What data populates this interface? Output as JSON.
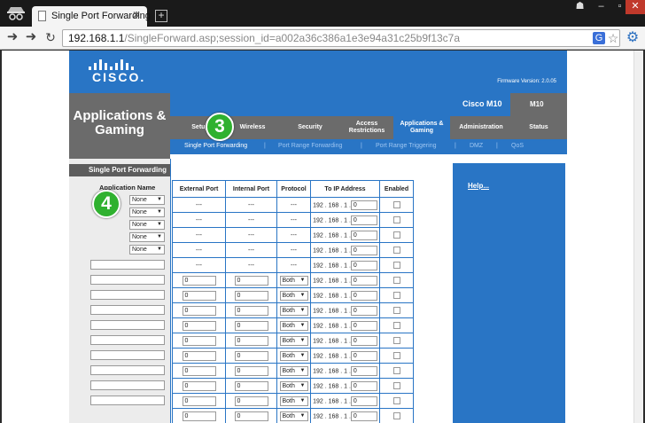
{
  "browser": {
    "tab_title": "Single Port Forwarding",
    "tab_close": "✕",
    "new_tab": "+",
    "url_host": "192.168.1.1",
    "url_path": "/SingleForward.asp;session_id=a002a36c386a1e3e94a31c25b9f13c7a"
  },
  "header": {
    "logo": "CISCO.",
    "firmware": "Firmware Version: 2.0.05",
    "section_title": "Applications & Gaming",
    "model_name": "Cisco M10",
    "model_short": "M10"
  },
  "main_tabs": [
    {
      "label": "Setup",
      "active": false
    },
    {
      "label": "Wireless",
      "active": false
    },
    {
      "label": "Security",
      "active": false
    },
    {
      "label": "Access Restrictions",
      "active": false
    },
    {
      "label": "Applications & Gaming",
      "active": true
    },
    {
      "label": "Administration",
      "active": false
    },
    {
      "label": "Status",
      "active": false
    }
  ],
  "sub_tabs": [
    {
      "label": "Single Port Forwarding",
      "current": true
    },
    {
      "label": "Port Range Forwarding",
      "current": false
    },
    {
      "label": "Port Range Triggering",
      "current": false
    },
    {
      "label": "DMZ",
      "current": false
    },
    {
      "label": "QoS",
      "current": false
    }
  ],
  "sub_sep": "|",
  "left": {
    "section": "Single Port Forwarding",
    "app_name_label": "Application Name",
    "preset_apps": [
      "None",
      "None",
      "None",
      "None",
      "None"
    ]
  },
  "table": {
    "headers": [
      "External Port",
      "Internal Port",
      "Protocol",
      "To IP Address",
      "Enabled"
    ],
    "preset_rows": [
      {
        "ext": "---",
        "int": "---",
        "proto": "---",
        "ip_prefix": "192 . 168 . 1 .",
        "ip_last": "0"
      },
      {
        "ext": "---",
        "int": "---",
        "proto": "---",
        "ip_prefix": "192 . 168 . 1 .",
        "ip_last": "0"
      },
      {
        "ext": "---",
        "int": "---",
        "proto": "---",
        "ip_prefix": "192 . 168 . 1 .",
        "ip_last": "0"
      },
      {
        "ext": "---",
        "int": "---",
        "proto": "---",
        "ip_prefix": "192 . 168 . 1 .",
        "ip_last": "0"
      },
      {
        "ext": "---",
        "int": "---",
        "proto": "---",
        "ip_prefix": "192 . 168 . 1 .",
        "ip_last": "0"
      }
    ],
    "custom_rows": [
      {
        "ext": "0",
        "int": "0",
        "proto": "Both",
        "ip_prefix": "192 . 168 . 1 .",
        "ip_last": "0"
      },
      {
        "ext": "0",
        "int": "0",
        "proto": "Both",
        "ip_prefix": "192 . 168 . 1 .",
        "ip_last": "0"
      },
      {
        "ext": "0",
        "int": "0",
        "proto": "Both",
        "ip_prefix": "192 . 168 . 1 .",
        "ip_last": "0"
      },
      {
        "ext": "0",
        "int": "0",
        "proto": "Both",
        "ip_prefix": "192 . 168 . 1 .",
        "ip_last": "0"
      },
      {
        "ext": "0",
        "int": "0",
        "proto": "Both",
        "ip_prefix": "192 . 168 . 1 .",
        "ip_last": "0"
      },
      {
        "ext": "0",
        "int": "0",
        "proto": "Both",
        "ip_prefix": "192 . 168 . 1 .",
        "ip_last": "0"
      },
      {
        "ext": "0",
        "int": "0",
        "proto": "Both",
        "ip_prefix": "192 . 168 . 1 .",
        "ip_last": "0"
      },
      {
        "ext": "0",
        "int": "0",
        "proto": "Both",
        "ip_prefix": "192 . 168 . 1 .",
        "ip_last": "0"
      },
      {
        "ext": "0",
        "int": "0",
        "proto": "Both",
        "ip_prefix": "192 . 168 . 1 .",
        "ip_last": "0"
      },
      {
        "ext": "0",
        "int": "0",
        "proto": "Both",
        "ip_prefix": "192 . 168 . 1 .",
        "ip_last": "0"
      }
    ]
  },
  "help": {
    "label": "Help..."
  },
  "badges": {
    "step3": "3",
    "step4": "4"
  },
  "icons": {
    "back": "back-arrow-icon",
    "forward": "forward-arrow-icon",
    "reload": "reload-icon",
    "star": "star-icon",
    "settings": "wrench-gear-icon",
    "translate": "translate-icon"
  },
  "colors": {
    "cisco_blue": "#2975c5",
    "cisco_gray": "#6b6b6b",
    "badge_green": "#2fb12f"
  }
}
